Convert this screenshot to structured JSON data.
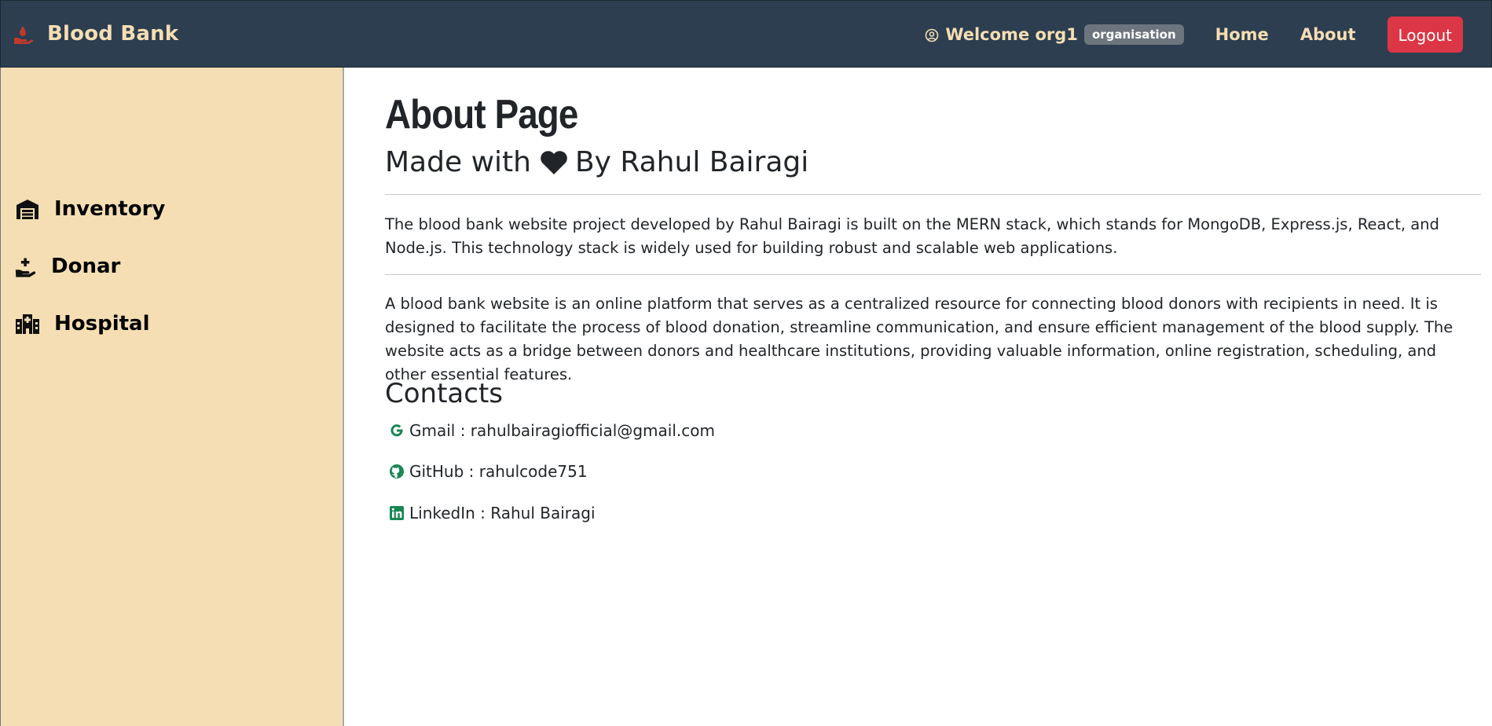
{
  "navbar": {
    "brand_icon": "hand-holding-blood-icon",
    "brand_title": "Blood Bank",
    "user_icon": "user-circle-icon",
    "welcome_text": "Welcome org1",
    "role_badge": "organisation",
    "links": [
      "Home",
      "About"
    ],
    "logout_label": "Logout"
  },
  "sidebar": {
    "items": [
      {
        "label": "Inventory",
        "icon": "warehouse-icon"
      },
      {
        "label": "Donar",
        "icon": "hand-holding-medical-icon"
      },
      {
        "label": "Hospital",
        "icon": "hospital-icon"
      }
    ]
  },
  "main": {
    "title": "About Page",
    "subtitle_prefix": "Made with",
    "subtitle_icon": "heart-icon",
    "subtitle_suffix": "By Rahul Bairagi",
    "paragraph1": "The blood bank website project developed by Rahul Bairagi is built on the MERN stack, which stands for MongoDB, Express.js, React, and Node.js. This technology stack is widely used for building robust and scalable web applications.",
    "paragraph2": "A blood bank website is an online platform that serves as a centralized resource for connecting blood donors with recipients in need. It is designed to facilitate the process of blood donation, streamline communication, and ensure efficient management of the blood supply. The website acts as a bridge between donors and healthcare institutions, providing valuable information, online registration, scheduling, and other essential features.",
    "contacts_title": "Contacts",
    "contacts": [
      {
        "text": "Gmail : rahulbairagiofficial@gmail.com",
        "icon": "google-icon"
      },
      {
        "text": "GitHub : rahulcode751",
        "icon": "github-icon"
      },
      {
        "text": "LinkedIn : Rahul Bairagi",
        "icon": "linkedin-icon"
      }
    ]
  },
  "colors": {
    "navbar_bg": "#2c3e50",
    "accent_text": "#f5deb3",
    "sidebar_bg": "#f5deb3",
    "logout_bg": "#dc3545",
    "contact_icon": "#198754"
  }
}
